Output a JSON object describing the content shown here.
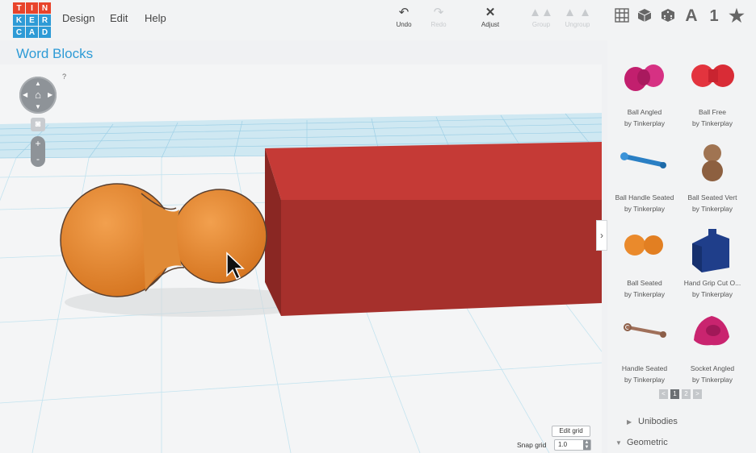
{
  "app": {
    "logo_letters": [
      "T",
      "I",
      "N",
      "K",
      "E",
      "R",
      "C",
      "A",
      "D"
    ],
    "logo_colors": [
      "#e8442b",
      "#e8442b",
      "#e8442b",
      "#2e9bd6",
      "#2e9bd6",
      "#2e9bd6",
      "#2e9bd6",
      "#2e9bd6",
      "#2e9bd6"
    ]
  },
  "menu": {
    "design": "Design",
    "edit": "Edit",
    "help": "Help"
  },
  "toolbar": {
    "undo": "Undo",
    "redo": "Redo",
    "adjust": "Adjust",
    "group": "Group",
    "ungroup": "Ungroup"
  },
  "view_icons": {
    "grid": "grid-view-icon",
    "box": "box-icon",
    "dice": "dice-icon",
    "text": "A",
    "number": "1",
    "star": "star-icon"
  },
  "project": {
    "title": "Word Blocks"
  },
  "nav": {
    "help": "?"
  },
  "sidebar": {
    "parts": [
      {
        "name": "Ball Angled",
        "author": "by Tinkerplay",
        "color": "#d4247e"
      },
      {
        "name": "Ball Free",
        "author": "by Tinkerplay",
        "color": "#e0353f"
      },
      {
        "name": "Ball Handle Seated",
        "author": "by Tinkerplay",
        "color": "#2a7fc4"
      },
      {
        "name": "Ball Seated Vert",
        "author": "by Tinkerplay",
        "color": "#9b6a46"
      },
      {
        "name": "Ball Seated",
        "author": "by Tinkerplay",
        "color": "#ea8a2c"
      },
      {
        "name": "Hand Grip Cut O...",
        "author": "by Tinkerplay",
        "color": "#1f3e8a"
      },
      {
        "name": "Handle Seated",
        "author": "by Tinkerplay",
        "color": "#a0705a"
      },
      {
        "name": "Socket Angled",
        "author": "by Tinkerplay",
        "color": "#c9246f"
      }
    ],
    "pager": {
      "prev": "<",
      "pages": [
        "1",
        "2"
      ],
      "next": ">"
    },
    "sections": [
      {
        "label": "Unibodies",
        "arrow": "▶"
      },
      {
        "label": "Geometric",
        "arrow": "▼"
      }
    ]
  },
  "grid_controls": {
    "edit_grid": "Edit grid",
    "snap_label": "Snap grid",
    "snap_value": "1.0"
  }
}
